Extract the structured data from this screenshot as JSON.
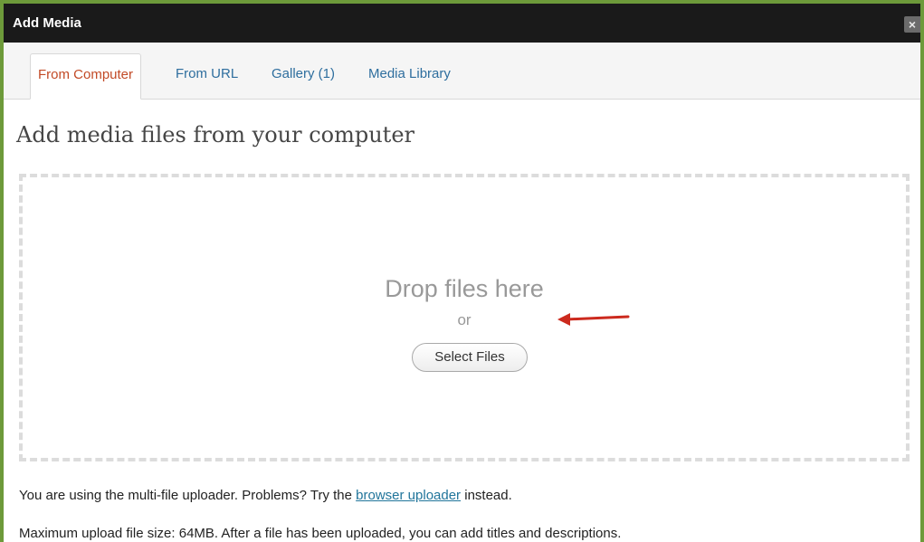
{
  "window": {
    "title": "Add Media",
    "close_glyph": "×",
    "close_icon": "close-icon"
  },
  "tabs": [
    {
      "label": "From Computer",
      "active": true
    },
    {
      "label": "From URL",
      "active": false
    },
    {
      "label": "Gallery (1)",
      "active": false
    },
    {
      "label": "Media Library",
      "active": false
    }
  ],
  "main": {
    "heading": "Add media files from your computer",
    "drop_text": "Drop files here",
    "or_text": "or",
    "select_button": "Select Files",
    "arrow_icon": "red-arrow-icon"
  },
  "info": {
    "uploader_prefix": "You are using the multi-file uploader. Problems? Try the",
    "uploader_link": "browser uploader",
    "uploader_suffix": "instead.",
    "max_size_text": "Maximum upload file size: 64MB. After a file has been uploaded, you can add titles and descriptions."
  },
  "colors": {
    "frame_border": "#6d9a3a",
    "titlebar_bg": "#1a1a1a",
    "active_tab": "#c24a26",
    "link": "#2e6e9e",
    "arrow": "#cc2a1e"
  }
}
